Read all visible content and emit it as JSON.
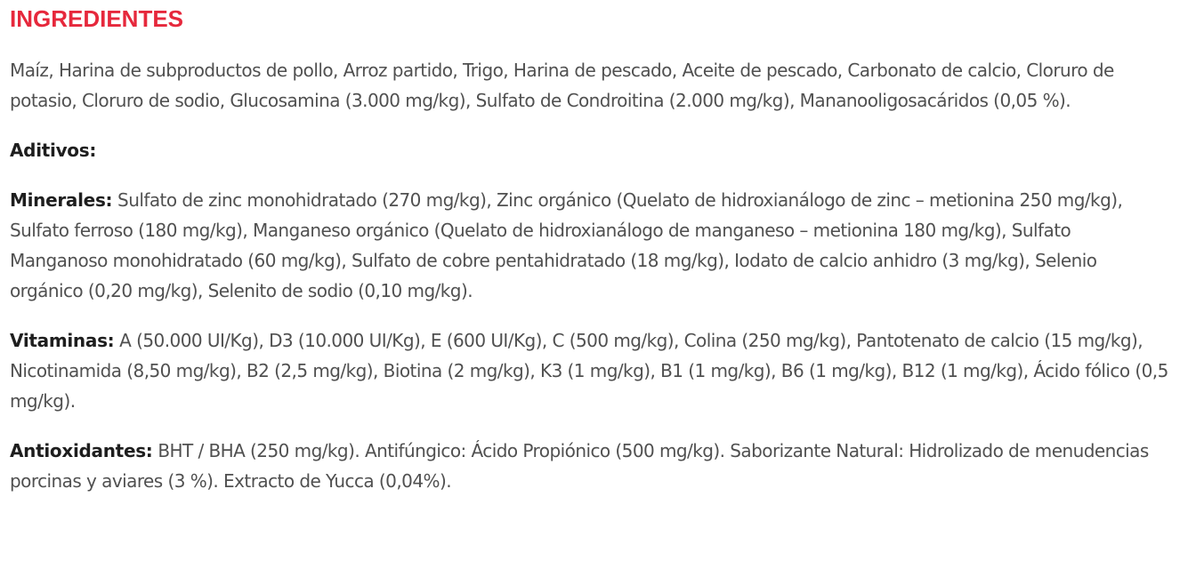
{
  "title": "INGREDIENTES",
  "colors": {
    "title": "#e6283c",
    "label": "#1e1e1e",
    "body": "#505050"
  },
  "ingredients_text": "Maíz, Harina de subproductos de pollo, Arroz partido, Trigo, Harina de pescado, Aceite de pescado, Carbonato de calcio, Cloruro de potasio, Cloruro de sodio, Glucosamina (3.000 mg/kg), Sulfato de Condroitina (2.000 mg/kg), Mananooligosacáridos (0,05 %).",
  "aditivos_label": "Aditivos:",
  "minerales": {
    "label": "Minerales:",
    "text": " Sulfato de zinc monohidratado (270 mg/kg), Zinc orgánico (Quelato de hidroxianálogo de zinc – metionina 250 mg/kg), Sulfato ferroso (180 mg/kg), Manganeso orgánico (Quelato de hidroxianálogo de manganeso – metionina 180 mg/kg), Sulfato Manganoso monohidratado (60 mg/kg), Sulfato de cobre pentahidratado (18 mg/kg), Iodato de calcio anhidro (3 mg/kg), Selenio orgánico (0,20 mg/kg), Selenito de sodio (0,10 mg/kg)."
  },
  "vitaminas": {
    "label": "Vitaminas:",
    "text": " A (50.000 UI/Kg), D3 (10.000 UI/Kg), E (600 UI/Kg), C (500 mg/kg), Colina (250 mg/kg), Pantotenato de calcio (15 mg/kg), Nicotinamida (8,50 mg/kg), B2 (2,5 mg/kg), Biotina (2 mg/kg), K3 (1 mg/kg), B1 (1 mg/kg), B6 (1 mg/kg), B12 (1 mg/kg), Ácido fólico (0,5 mg/kg)."
  },
  "antioxidantes": {
    "label": "Antioxidantes:",
    "text": " BHT / BHA (250 mg/kg). Antifúngico: Ácido Propiónico (500 mg/kg). Saborizante Natural: Hidrolizado de menudencias porcinas y aviares (3 %). Extracto de Yucca (0,04%)."
  }
}
